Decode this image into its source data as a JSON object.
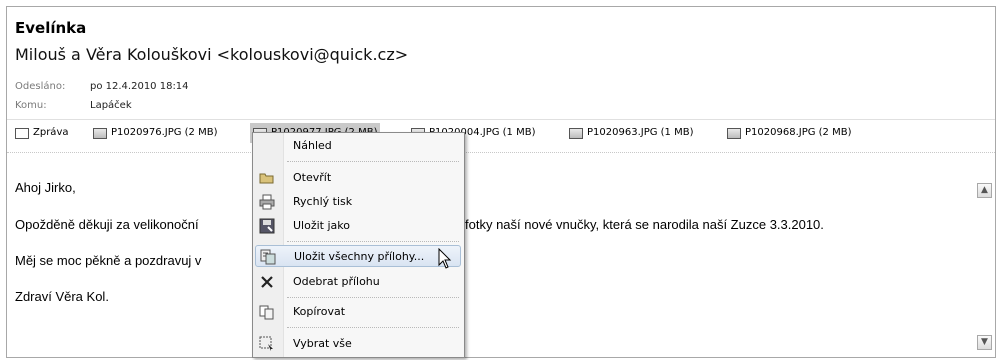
{
  "message": {
    "subject": "Evelínka",
    "sender": "Milouš a Věra Kolouškovi <kolouskovi@quick.cz>",
    "sent_label": "Odesláno:",
    "sent_value": "po 12.4.2010 18:14",
    "to_label": "Komu:",
    "to_value": "Lapáček"
  },
  "tabs": [
    {
      "label": "Zpráva",
      "icon": "envelope-icon"
    },
    {
      "label": "P1020976.JPG (2 MB)",
      "icon": "image-file-icon"
    },
    {
      "label": "P1020977.JPG (2 MB)",
      "icon": "image-file-icon",
      "selected": true
    },
    {
      "label": "P1020004.JPG (1 MB)",
      "icon": "image-file-icon"
    },
    {
      "label": "P1020963.JPG (1 MB)",
      "icon": "image-file-icon"
    },
    {
      "label": "P1020968.JPG (2 MB)",
      "icon": "image-file-icon"
    }
  ],
  "body_lines": {
    "l1": "Ahoj Jirko,",
    "l2a": "Opožděně děkuji za velikonoční",
    "l2b": "fotky naší nové vnučky, která se narodila naší Zuzce 3.3.2010.",
    "l3": "Měj se moc pěkně a pozdravuj v",
    "l4": "Zdraví Věra Kol."
  },
  "context_menu": {
    "items": [
      {
        "label": "Náhled",
        "accel": "N",
        "icon": ""
      },
      {
        "label": "Otevřít",
        "accel": "O",
        "icon": "open-folder-icon"
      },
      {
        "label": "Rychlý tisk",
        "accel": "R",
        "icon": "printer-icon"
      },
      {
        "label": "Uložit jako",
        "accel": "U",
        "icon": "save-as-icon"
      },
      {
        "label": "Uložit všechny přílohy...",
        "accel": "U",
        "icon": "save-all-icon",
        "highlighted": true
      },
      {
        "label": "Odebrat přílohu",
        "accel": "b",
        "icon": "remove-x-icon"
      },
      {
        "label": "Kopírovat",
        "accel": "K",
        "icon": "copy-icon"
      },
      {
        "label": "Vybrat vše",
        "accel": "a",
        "icon": "select-all-icon"
      }
    ]
  }
}
